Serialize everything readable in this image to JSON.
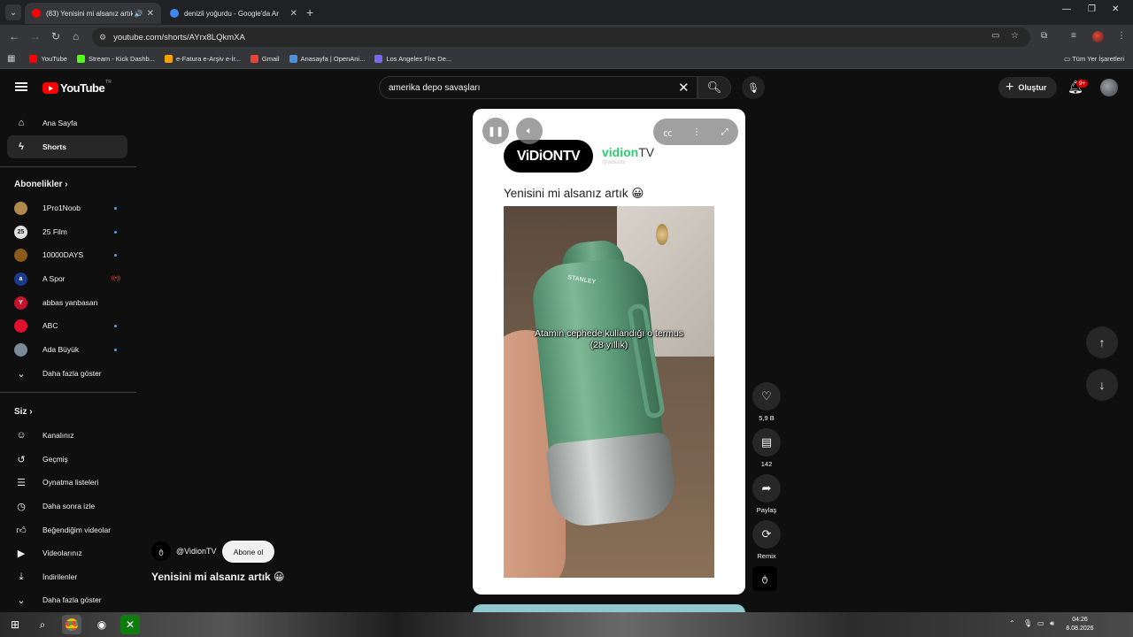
{
  "browser": {
    "tabs": [
      {
        "title": "(83) Yenisini mi alsanız artık",
        "active": true,
        "favicon_color": "#ff0000"
      },
      {
        "title": "denizli yoğurdu - Google'da Ar",
        "active": false,
        "favicon_color": "#4285f4"
      }
    ],
    "url": "youtube.com/shorts/AYrx8LQkmXA",
    "bookmarks": [
      {
        "label": "YouTube",
        "color": "#ff0000"
      },
      {
        "label": "Stream - Kick Dashb...",
        "color": "#53fc18"
      },
      {
        "label": "e-Fatura e-Arşiv e-İr...",
        "color": "#f4a300"
      },
      {
        "label": "Gmail",
        "color": "#ea4335"
      },
      {
        "label": "Anasayfa | OpenAni...",
        "color": "#4a90e2"
      },
      {
        "label": "Los Angeles Fire De...",
        "color": "#7b68ee"
      }
    ],
    "all_bookmarks": "Tüm Yer İşaretleri"
  },
  "header": {
    "logo": "YouTube",
    "logo_country": "TR",
    "search_value": "amerika depo savaşları",
    "create_label": "Oluştur",
    "notif_count": "9+"
  },
  "sidebar": {
    "main": [
      {
        "label": "Ana Sayfa",
        "icon": "home-icon"
      },
      {
        "label": "Shorts",
        "icon": "shorts-icon"
      }
    ],
    "subs_header": "Abonelikler",
    "subs": [
      {
        "label": "1Pro1Noob",
        "color": "#b08a4a",
        "status": "dot"
      },
      {
        "label": "25 Film",
        "color": "#e0e0e0",
        "status": "dot"
      },
      {
        "label": "10000DAYS",
        "color": "#8a5a1a",
        "status": "dot"
      },
      {
        "label": "A Spor",
        "color": "#1a3a8a",
        "status": "live"
      },
      {
        "label": "abbas yanbasan",
        "color": "#c4122f",
        "status": "none"
      },
      {
        "label": "ABC",
        "color": "#e0102f",
        "status": "dot"
      },
      {
        "label": "Ada Büyük",
        "color": "#7a8a9a",
        "status": "dot"
      }
    ],
    "subs_more": "Daha fazla göster",
    "you_header": "Siz",
    "you": [
      {
        "label": "Kanalınız",
        "icon": "channel-icon"
      },
      {
        "label": "Geçmiş",
        "icon": "history-icon"
      },
      {
        "label": "Oynatma listeleri",
        "icon": "playlist-icon"
      },
      {
        "label": "Daha sonra izle",
        "icon": "clock-icon"
      },
      {
        "label": "Beğendiğim videolar",
        "icon": "thumbs-up-icon"
      },
      {
        "label": "Videolarınız",
        "icon": "video-icon"
      },
      {
        "label": "İndirilenler",
        "icon": "download-icon"
      },
      {
        "label": "Daha fazla göster",
        "icon": "chevron-down-icon"
      }
    ]
  },
  "short": {
    "brand_logo": "ViDiONTV",
    "brand_name_green": "vidion",
    "brand_name_dark": "TV",
    "brand_handle": "@vidiontv",
    "caption": "Yenisini mi alsanız artık 😀",
    "thermos_brand": "STANLEY",
    "overlay_line1": "Atamın cephede kullandığı o termus",
    "overlay_line2": "(28 yıllık)",
    "likes": "5,9 B",
    "comments": "142",
    "share": "Paylaş",
    "remix": "Remix",
    "channel_handle": "@VidionTV",
    "subscribe": "Abone ol",
    "title": "Yenisini mi alsanız artık 😀"
  },
  "taskbar": {
    "time": "04:26",
    "date": "8.08.2026"
  }
}
